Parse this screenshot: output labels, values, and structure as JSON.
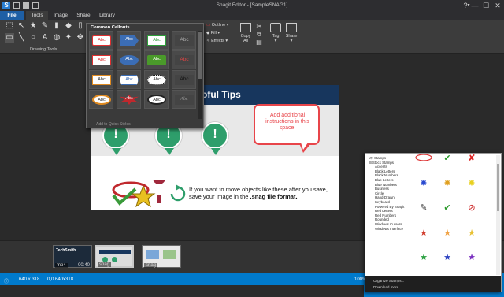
{
  "window": {
    "title": "Snagit Editor - [SampleSNAG1]",
    "help": "?",
    "help_arrow": "▾",
    "minimize": "—",
    "maximize": "☐",
    "close": "✕"
  },
  "tabs": [
    "File",
    "Tools",
    "Image",
    "Share",
    "Library"
  ],
  "ribbon": {
    "drawing_tools_label": "Drawing Tools",
    "outline": "Outline ▾",
    "fill": "Fill ▾",
    "effects": "Effects ▾",
    "copy_all": "Copy All",
    "tag": "Tag",
    "share": "Share",
    "dropdown_arrow": "▾"
  },
  "callouts": {
    "title": "Common Callouts",
    "footer": "Add to Quick Styles",
    "cells": [
      "Abc",
      "Abc",
      "Abc",
      "Abc",
      "Abc",
      "Abc",
      "Abc",
      "Abc",
      "Abc",
      "Abc",
      "Abc",
      "Abc",
      "Abc",
      "Abc",
      "Abc",
      "Abc"
    ]
  },
  "document": {
    "header": "oful Tips",
    "callout_text": "Add additional instructions in this space.",
    "bottom_text_1": "If you want to move objects like these after you save,",
    "bottom_text_2_plain": "save your image in the ",
    "bottom_text_2_bold": ".snag file format."
  },
  "tray": {
    "items": [
      {
        "label": "mp4",
        "time": "00:40",
        "logo": "TechSmith"
      },
      {
        "label": "snag"
      },
      {
        "label": "snag"
      }
    ]
  },
  "status": {
    "dimensions": "640 x 318",
    "coords": "0,0  640x318",
    "zoom": "100%"
  },
  "stamps": {
    "categories": [
      "My Stamps",
      "Stock Stamps",
      "Accents",
      "Black Letters",
      "Black Numbers",
      "Blue Letters",
      "Blue Numbers",
      "Business",
      "Circle",
      "Hand-Drawn",
      "Keyboard",
      "Powered By Snagit",
      "Red Letters",
      "Red Numbers",
      "Rounded",
      "Windows Cursors",
      "Windows Interface"
    ],
    "organize": "Organize Stamps...",
    "download": "Download more..."
  },
  "colors": {
    "accent": "#007acc",
    "file_tab": "#1e5fa5",
    "doc_header": "#17365d",
    "callout_red": "#e8454a",
    "pin_green": "#2e9e6b"
  }
}
